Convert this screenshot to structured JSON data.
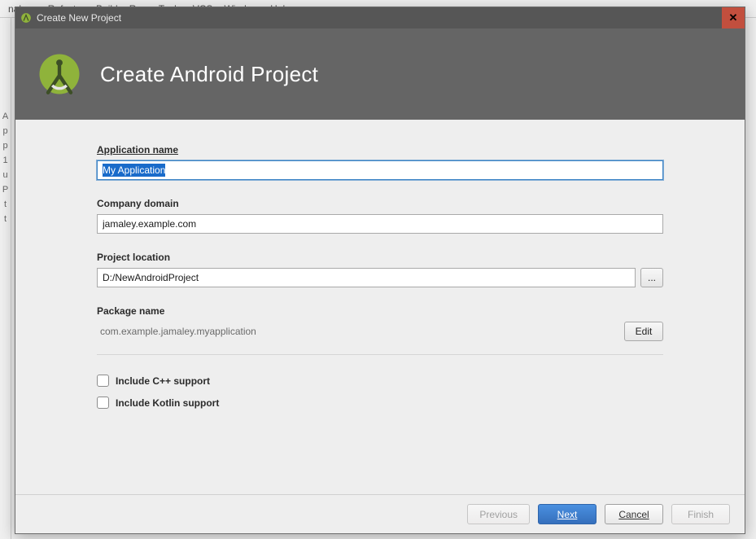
{
  "menubar": {
    "items": [
      "nalyze",
      "Refactor",
      "Build",
      "Run",
      "Tools",
      "VCS",
      "Window",
      "Help"
    ]
  },
  "dialog": {
    "window_title": "Create New Project",
    "close_glyph": "✕",
    "header_title": "Create Android Project"
  },
  "fields": {
    "app_name_label": "Application name",
    "app_name_value": "My Application",
    "company_domain_label": "Company domain",
    "company_domain_value": "jamaley.example.com",
    "project_location_label": "Project location",
    "project_location_value": "D:/NewAndroidProject",
    "browse_label": "...",
    "package_name_label": "Package name",
    "package_name_value": "com.example.jamaley.myapplication",
    "edit_label": "Edit"
  },
  "checks": {
    "cpp_label": "Include C++ support",
    "kotlin_label": "Include Kotlin support"
  },
  "buttons": {
    "previous": "Previous",
    "next": "Next",
    "cancel": "Cancel",
    "finish": "Finish"
  },
  "left_strip": [
    "A",
    "p",
    "p",
    "1",
    "u",
    "P",
    "t",
    "t"
  ]
}
